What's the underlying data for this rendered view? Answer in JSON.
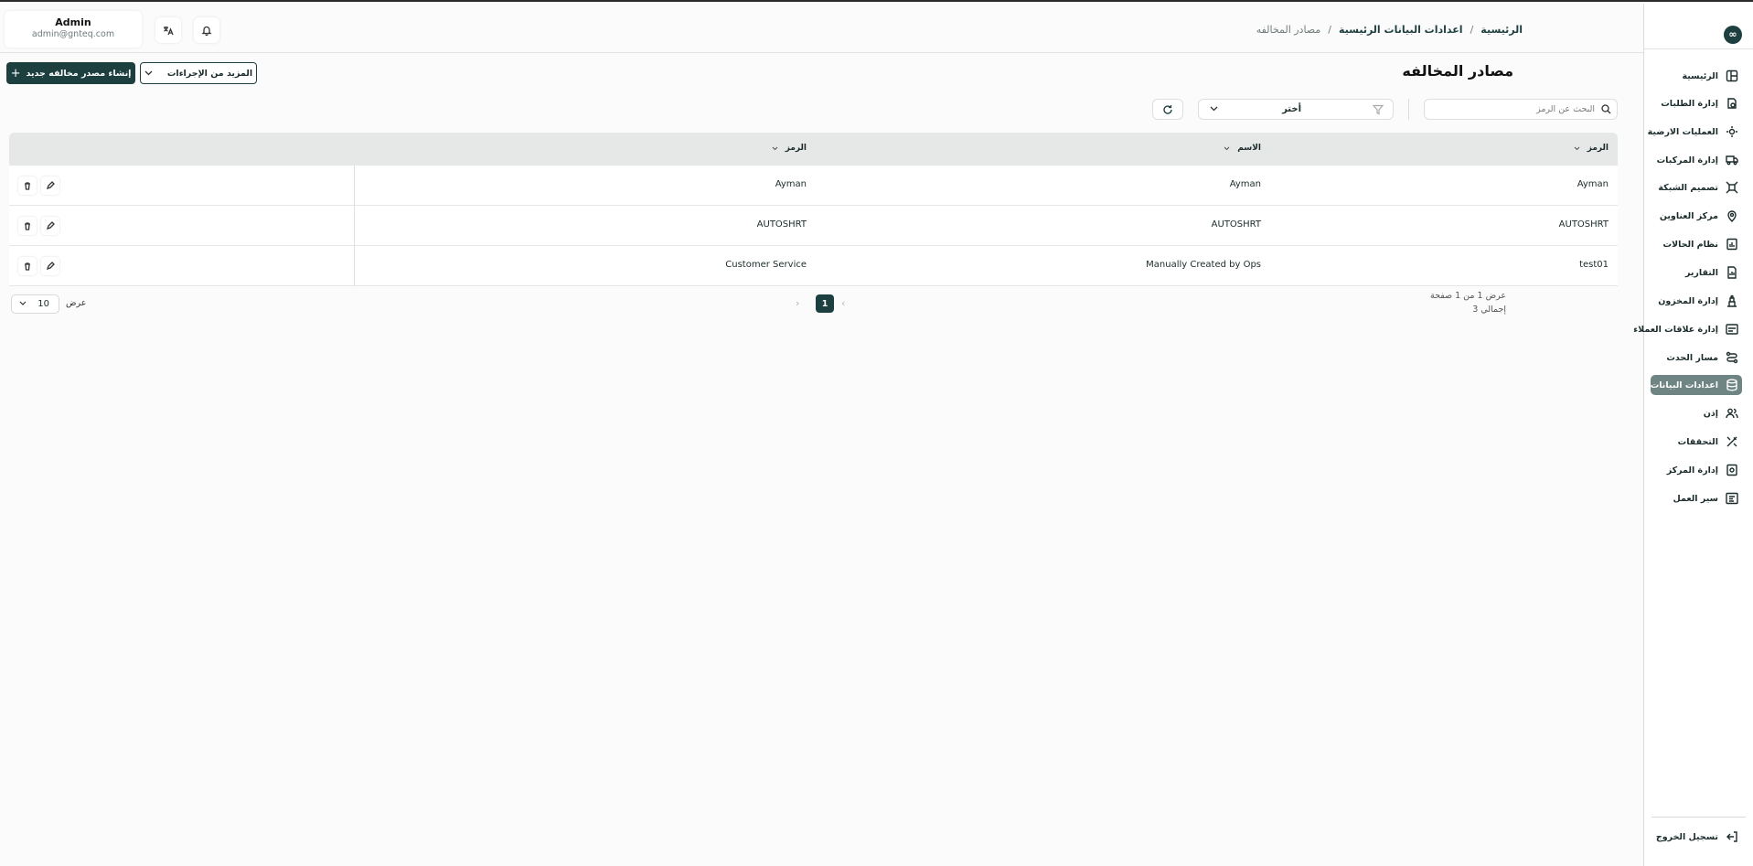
{
  "header": {
    "breadcrumb": [
      "الرئيسية",
      "اعدادات البيانات الرئيسية",
      "مصادر المخالفه"
    ],
    "user_name": "Admin",
    "user_email": "admin@gnteq.com"
  },
  "sidebar": {
    "items": [
      {
        "label": "الرئيسية",
        "icon": "layout-icon"
      },
      {
        "label": "إدارة الطلبات",
        "icon": "orders-icon"
      },
      {
        "label": "العمليات الارضية",
        "icon": "ground-ops-icon"
      },
      {
        "label": "إدارة المركبات",
        "icon": "truck-icon"
      },
      {
        "label": "تصميم الشبكة",
        "icon": "network-icon"
      },
      {
        "label": "مركز العناوين",
        "icon": "address-icon"
      },
      {
        "label": "نظام الحالات",
        "icon": "status-icon"
      },
      {
        "label": "التقارير",
        "icon": "report-icon"
      },
      {
        "label": "إدارة المخزون",
        "icon": "inventory-icon"
      },
      {
        "label": "إدارة علاقات العملاء",
        "icon": "crm-icon"
      },
      {
        "label": "مسار الحدث",
        "icon": "route-icon"
      },
      {
        "label": "اعدادات البيانات",
        "icon": "database-icon",
        "active": true
      },
      {
        "label": "إذن",
        "icon": "users-icon"
      },
      {
        "label": "التحققات",
        "icon": "tools-icon"
      },
      {
        "label": "إدارة المركز",
        "icon": "hub-icon"
      },
      {
        "label": "سير العمل",
        "icon": "workflow-icon"
      }
    ],
    "logout_label": "تسجيل الخروج"
  },
  "page": {
    "title": "مصادر المخالفه",
    "create_button": "إنشاء مصدر مخالفه جديد",
    "more_actions_button": "المزيد من الإجراءات",
    "search_placeholder": "البحث عن الرمز",
    "filter_value": "أختر"
  },
  "table": {
    "columns": [
      "الرمز",
      "الاسم",
      "الرمز"
    ],
    "rows": [
      [
        "Ayman",
        "Ayman",
        "Ayman"
      ],
      [
        "AUTOSHRT",
        "AUTOSHRT",
        "AUTOSHRT"
      ],
      [
        "test01",
        "Manually Created by Ops",
        "Customer Service"
      ]
    ]
  },
  "pagination": {
    "info_pages": "عرض 1 من 1 صفحة",
    "info_total": "إجمالي 3",
    "current_page": "1",
    "page_size": "10",
    "page_size_label": "عرض"
  },
  "colors": {
    "primary": "#1e3f40",
    "active_sidebar": "#6e8584",
    "header_row": "#e6e8e8"
  }
}
